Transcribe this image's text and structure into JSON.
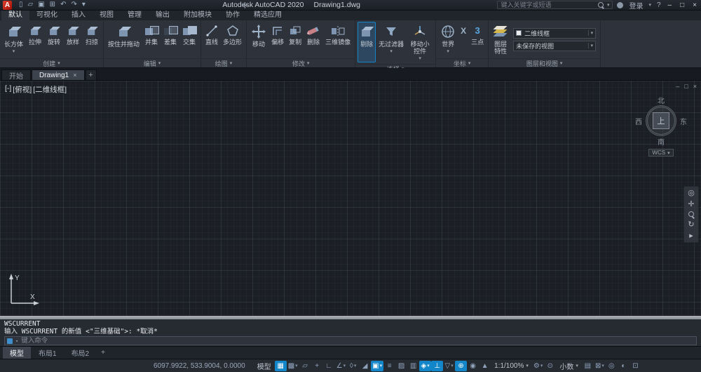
{
  "colors": {
    "accent": "#1286c8",
    "logo_red": "#c0291c",
    "canvas_bg": "#1b1f25"
  },
  "titlebar": {
    "logo": "A",
    "qat_icons": [
      {
        "name": "new-file-icon",
        "glyph": "▯"
      },
      {
        "name": "open-file-icon",
        "glyph": "▱"
      },
      {
        "name": "save-icon",
        "glyph": "▣"
      },
      {
        "name": "plot-icon",
        "glyph": "⊞"
      },
      {
        "name": "undo-icon",
        "glyph": "↶"
      },
      {
        "name": "redo-icon",
        "glyph": "↷"
      },
      {
        "name": "qat-dropdown-icon",
        "glyph": "▾"
      }
    ],
    "app_title": "Autodesk AutoCAD 2020",
    "doc_title": "Drawing1.dwg",
    "search_placeholder": "键入关键字或短语",
    "login_label": "登录",
    "help_label": "?",
    "window_minimize": "–",
    "window_restore": "□",
    "window_close": "×"
  },
  "ribbon_tabs": [
    {
      "label": "默认",
      "active": true
    },
    {
      "label": "可视化",
      "active": false
    },
    {
      "label": "插入",
      "active": false
    },
    {
      "label": "视图",
      "active": false
    },
    {
      "label": "管理",
      "active": false
    },
    {
      "label": "输出",
      "active": false
    },
    {
      "label": "附加模块",
      "active": false
    },
    {
      "label": "协作",
      "active": false
    },
    {
      "label": "精选应用",
      "active": false
    }
  ],
  "ribbon": {
    "create": {
      "title": "创建",
      "box": "长方体",
      "extrude": "拉伸",
      "revolve": "旋转",
      "loft": "放样",
      "sweep": "扫掠"
    },
    "edit": {
      "title": "编辑",
      "presspull": "按住并拖动",
      "union": "并集",
      "subtract": "差集",
      "intersect": "交集"
    },
    "draw": {
      "title": "绘图",
      "line": "直线",
      "polygon": "多边形"
    },
    "modify": {
      "title": "修改",
      "move": "移动",
      "offset": "偏移",
      "copy": "复制",
      "erase": "删除",
      "mirror3d": "三维镜像"
    },
    "selection": {
      "title": "选择",
      "culling": "剔除",
      "nofilter": "无过滤器",
      "gizmo": "移动小控件"
    },
    "coords": {
      "title": "坐标",
      "world": "世界",
      "x": "X",
      "three_glyph": "3",
      "threepoint": "三点"
    },
    "layers": {
      "title": "图层和视图",
      "layer_props": "图层特性",
      "visual_style": "二维线框",
      "view": "未保存的视图"
    }
  },
  "file_tabs": {
    "start": "开始",
    "drawing": "Drawing1",
    "close": "×",
    "new_tab": "+"
  },
  "canvas": {
    "viewport_controls": [
      "[-]",
      "[俯视]",
      "[二维线框]"
    ],
    "viewcube": {
      "north": "北",
      "south": "南",
      "west": "西",
      "east": "东",
      "top": "上",
      "wcs": "WCS"
    },
    "navbar_icons": [
      {
        "name": "navigation-wheel-icon",
        "glyph": "◎"
      },
      {
        "name": "pan-icon",
        "glyph": "✛"
      },
      {
        "name": "zoom-icon",
        "glyph": "mag"
      },
      {
        "name": "orbit-icon",
        "glyph": "↻"
      },
      {
        "name": "showmotion-icon",
        "glyph": "▸"
      }
    ],
    "ucs": {
      "x": "X",
      "y": "Y"
    },
    "window_minimize": "–",
    "window_restore": "□",
    "window_close": "×"
  },
  "command": {
    "history": [
      "WSCURRENT",
      "输入 WSCURRENT 的新值 <\"三维基础\">: *取消*"
    ],
    "placeholder": "键入命令"
  },
  "layout_tabs": [
    {
      "label": "模型",
      "active": true
    },
    {
      "label": "布局1",
      "active": false
    },
    {
      "label": "布局2",
      "active": false
    }
  ],
  "layout_new": "+",
  "statusbar": {
    "coords": "6097.9922, 533.9004, 0.0000",
    "items": [
      {
        "type": "text",
        "name": "model-paper-toggle",
        "label": "模型"
      },
      {
        "type": "icon",
        "name": "grid-icon",
        "glyph": "▦",
        "active": true
      },
      {
        "type": "icon",
        "name": "snap-mode-icon",
        "glyph": "▩",
        "dd": true
      },
      {
        "type": "icon",
        "name": "infer-constraints-icon",
        "glyph": "▱"
      },
      {
        "type": "icon",
        "name": "dynamic-input-icon",
        "glyph": "+"
      },
      {
        "type": "icon",
        "name": "ortho-icon",
        "glyph": "∟"
      },
      {
        "type": "icon",
        "name": "polar-tracking-icon",
        "glyph": "∠",
        "dd": true
      },
      {
        "type": "icon",
        "name": "isodraft-icon",
        "glyph": "◊",
        "dd": true
      },
      {
        "type": "icon",
        "name": "object-snap-tracking-icon",
        "glyph": "◢"
      },
      {
        "type": "icon",
        "name": "object-snap-icon",
        "glyph": "▣",
        "active": true,
        "dd": true
      },
      {
        "type": "icon",
        "name": "lineweight-icon",
        "glyph": "≡"
      },
      {
        "type": "icon",
        "name": "transparency-icon",
        "glyph": "▨"
      },
      {
        "type": "icon",
        "name": "selection-cycling-icon",
        "glyph": "▥"
      },
      {
        "type": "icon",
        "name": "object-snap-3d-icon",
        "glyph": "◈",
        "active": true,
        "dd": true
      },
      {
        "type": "icon",
        "name": "dynamic-ucs-icon",
        "glyph": "⊥",
        "active": true
      },
      {
        "type": "icon",
        "name": "selection-filtering-icon",
        "glyph": "▽",
        "dd": true
      },
      {
        "type": "icon",
        "name": "gizmo-icon",
        "glyph": "⊕",
        "active": true
      },
      {
        "type": "icon",
        "name": "annotation-visibility-icon",
        "glyph": "◉"
      },
      {
        "type": "icon",
        "name": "autoscale-icon",
        "glyph": "▲"
      },
      {
        "type": "text",
        "name": "annotation-scale",
        "label": "1:1/100%",
        "dd": true
      },
      {
        "type": "icon",
        "name": "workspace-switching-icon",
        "glyph": "⚙",
        "dd": true
      },
      {
        "type": "icon",
        "name": "annotation-monitor-icon",
        "glyph": "⊙"
      },
      {
        "type": "text",
        "name": "units",
        "label": "小数",
        "dd": true
      },
      {
        "type": "icon",
        "name": "quick-properties-icon",
        "glyph": "▤"
      },
      {
        "type": "icon",
        "name": "lock-ui-icon",
        "glyph": "⊠",
        "dd": true
      },
      {
        "type": "icon",
        "name": "isolate-objects-icon",
        "glyph": "◎"
      },
      {
        "type": "icon",
        "name": "graphics-performance-icon",
        "glyph": "◐"
      },
      {
        "type": "icon",
        "name": "clean-screen-icon",
        "glyph": "⊡"
      }
    ]
  }
}
